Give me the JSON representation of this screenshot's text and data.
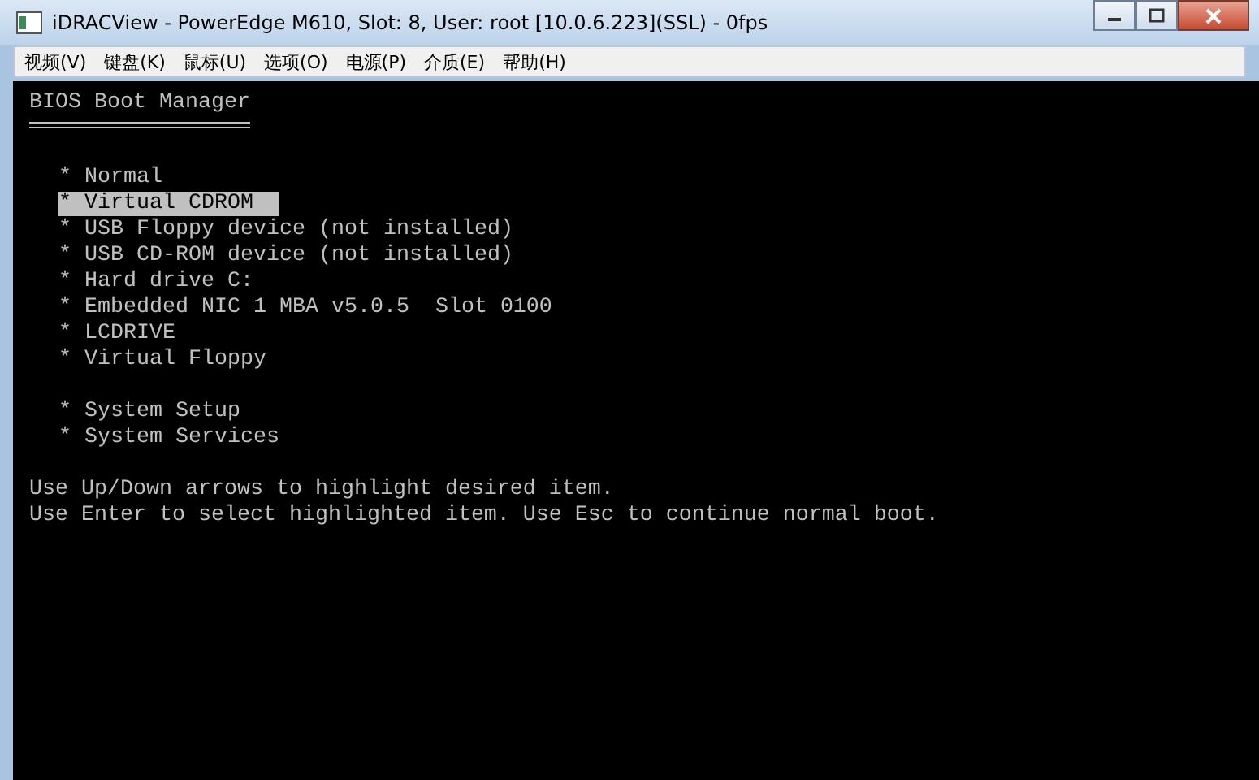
{
  "window": {
    "title": "iDRACView - PowerEdge M610, Slot: 8, User: root [10.0.6.223](SSL) - 0fps"
  },
  "menu": [
    "视频(V)",
    "键盘(K)",
    "鼠标(U)",
    "选项(O)",
    "电源(P)",
    "介质(E)",
    "帮助(H)"
  ],
  "console": {
    "heading": "BIOS Boot Manager",
    "boot_items": [
      {
        "label": "* Normal",
        "selected": false
      },
      {
        "label": "* Virtual CDROM",
        "selected": true
      },
      {
        "label": "* USB Floppy device (not installed)",
        "selected": false
      },
      {
        "label": "* USB CD-ROM device (not installed)",
        "selected": false
      },
      {
        "label": "* Hard drive C:",
        "selected": false
      },
      {
        "label": "* Embedded NIC 1 MBA v5.0.5  Slot 0100",
        "selected": false
      },
      {
        "label": "* LCDRIVE",
        "selected": false
      },
      {
        "label": "* Virtual Floppy",
        "selected": false
      }
    ],
    "system_items": [
      {
        "label": "* System Setup",
        "selected": false
      },
      {
        "label": "* System Services",
        "selected": false
      }
    ],
    "help_lines": [
      "Use Up/Down arrows to highlight desired item.",
      "Use Enter to select highlighted item. Use Esc to continue normal boot."
    ]
  }
}
